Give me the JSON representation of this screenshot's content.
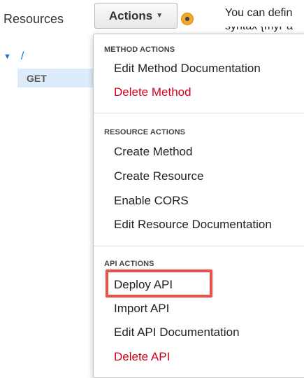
{
  "sidebar": {
    "title": "Resources",
    "root_label": "/",
    "method_label": "GET"
  },
  "toolbar": {
    "actions_label": "Actions"
  },
  "help_text": {
    "line1": "You can defin",
    "line2": "syntax {myPa"
  },
  "menu": {
    "method_actions": {
      "heading": "METHOD ACTIONS",
      "items": [
        "Edit Method Documentation",
        "Delete Method"
      ]
    },
    "resource_actions": {
      "heading": "RESOURCE ACTIONS",
      "items": [
        "Create Method",
        "Create Resource",
        "Enable CORS",
        "Edit Resource Documentation"
      ]
    },
    "api_actions": {
      "heading": "API ACTIONS",
      "items": [
        "Deploy API",
        "Import API",
        "Edit API Documentation",
        "Delete API"
      ]
    }
  },
  "colors": {
    "danger": "#d0021b",
    "highlight": "#e8524a",
    "selected_bg": "#dcecfa",
    "link": "#1a73c7"
  },
  "icons": {
    "tree_toggle": "caret-down-icon",
    "actions_dropdown": "caret-down-icon",
    "help": "info-dot-icon"
  }
}
